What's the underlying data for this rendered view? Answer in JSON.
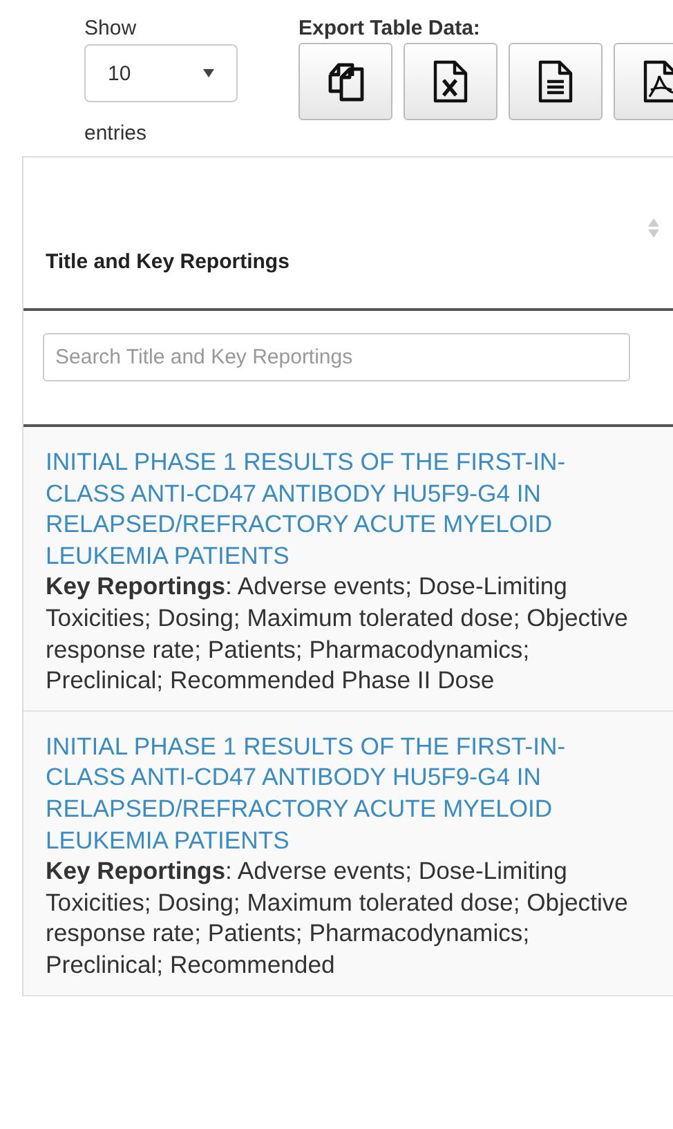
{
  "length_menu": {
    "before": "Show",
    "value": "10",
    "after": "entries"
  },
  "export": {
    "label": "Export Table Data:",
    "buttons": [
      {
        "kind": "copy"
      },
      {
        "kind": "excel"
      },
      {
        "kind": "csv"
      },
      {
        "kind": "pdf"
      }
    ]
  },
  "table": {
    "columns": [
      {
        "title": "Title and Key Reportings",
        "sortable": true,
        "search_placeholder": "Search Title and Key Reportings"
      }
    ],
    "rows": [
      {
        "title": "INITIAL PHASE 1 RESULTS OF THE FIRST-IN-CLASS ANTI-CD47 ANTIBODY HU5F9-G4 IN RELAPSED/REFRACTORY ACUTE MYELOID LEUKEMIA PATIENTS",
        "details": "**Key Reportings**: Adverse events; Dose-Limiting Toxicities; Dosing; Maximum tolerated dose; Objective response rate; Patients; Pharmacodynamics; Preclinical; Recommended Phase II Dose"
      },
      {
        "title": "INITIAL PHASE 1 RESULTS OF THE FIRST-IN-CLASS ANTI-CD47 ANTIBODY HU5F9-G4 IN RELAPSED/REFRACTORY ACUTE MYELOID LEUKEMIA PATIENTS",
        "details": "**Key Reportings**: Adverse events; Dose-Limiting Toxicities; Dosing; Maximum tolerated dose; Objective response rate; Patients; Pharmacodynamics; Preclinical; Recommended"
      }
    ]
  }
}
